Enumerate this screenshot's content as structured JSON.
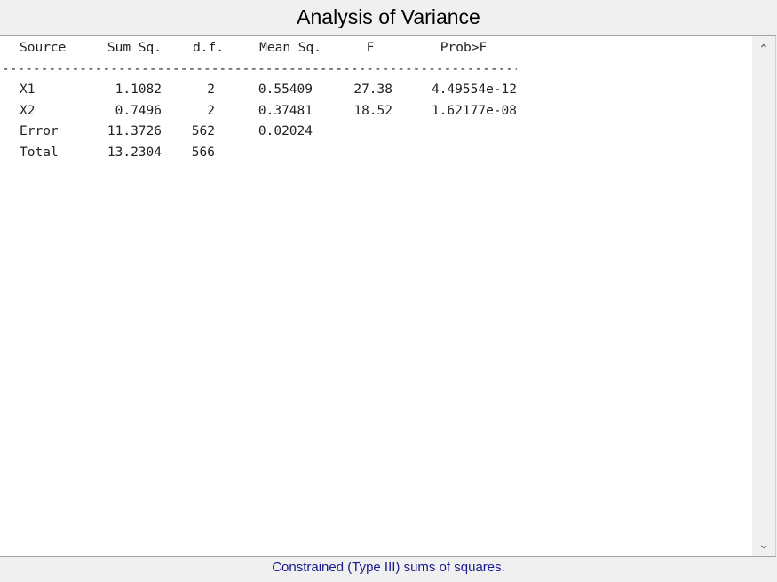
{
  "window": {
    "title": "Analysis of Variance"
  },
  "table": {
    "headers": [
      "Source",
      "Sum Sq.",
      "d.f.",
      "Mean Sq.",
      "F",
      "Prob>F"
    ],
    "rule": "----------------------------------------------------------------------------------------------------",
    "rows": [
      [
        "X1",
        "1.1082",
        "2",
        "0.55409",
        "27.38",
        "4.49554e-12"
      ],
      [
        "X2",
        "0.7496",
        "2",
        "0.37481",
        "18.52",
        "1.62177e-08"
      ],
      [
        "Error",
        "11.3726",
        "562",
        "0.02024",
        "",
        ""
      ],
      [
        "Total",
        "13.2304",
        "566",
        "",
        "",
        ""
      ]
    ]
  },
  "scrollbar": {
    "up_glyph": "⌃",
    "down_glyph": "⌄"
  },
  "footer": {
    "note": "Constrained (Type III) sums of squares."
  }
}
